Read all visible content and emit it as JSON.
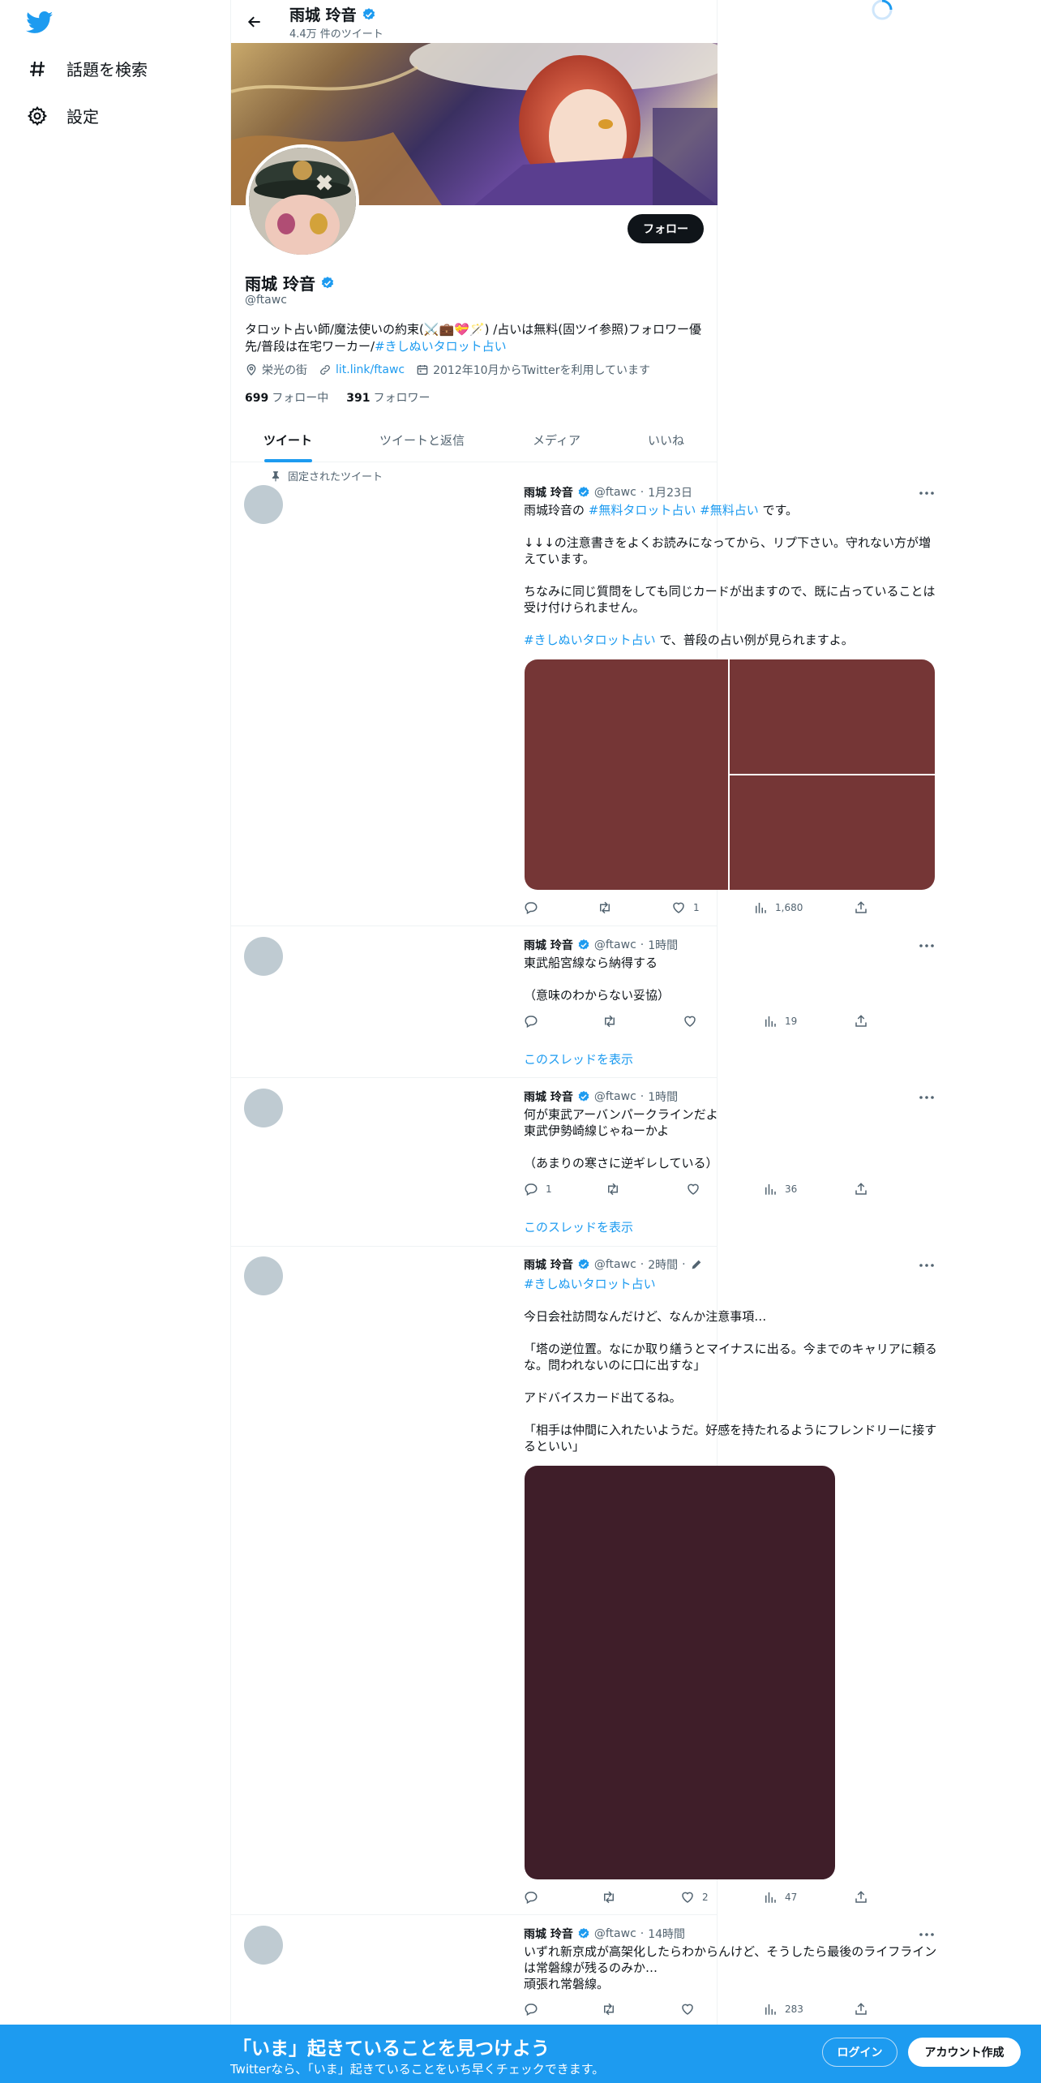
{
  "nav": {
    "logo_icon": "twitter-bird-icon",
    "items": [
      {
        "label": "話題を検索",
        "icon": "hashtag-icon"
      },
      {
        "label": "設定",
        "icon": "gear-icon"
      }
    ]
  },
  "header": {
    "name": "雨城 玲音",
    "tweet_count": "4.4万 件のツイート"
  },
  "profile": {
    "name": "雨城 玲音",
    "handle": "@ftawc",
    "follow_label": "フォロー",
    "bio_text": "タロット占い師/魔法使いの約束(⚔️💼💝🪄) /占いは無料(固ツイ参照)フォロワー優先/普段は在宅ワーカー/",
    "bio_hashtag": "#きしぬいタロット占い",
    "location": "栄光の街",
    "url": "lit.link/ftawc",
    "joined": "2012年10月からTwitterを利用しています",
    "following_count": "699",
    "following_label": "フォロー中",
    "followers_count": "391",
    "followers_label": "フォロワー"
  },
  "tabs": [
    "ツイート",
    "ツイートと返信",
    "メディア",
    "いいね"
  ],
  "pinned_label": "固定されたツイート",
  "tweets": [
    {
      "name": "雨城 玲音",
      "handle": "@ftawc",
      "time": "1月23日",
      "body_pre": "雨城玲音の ",
      "tag1": "#無料タロット占い",
      "tag2": "#無料占い",
      "body_post": " です。",
      "para2": "↓↓↓の注意書きをよくお読みになってから、リプ下さい。守れない方が増えています。",
      "para3": "ちなみに同じ質問をしても同じカードが出ますので、既に占っていることは受け付けられません。",
      "tag3": "#きしぬいタロット占い",
      "para4": " で、普段の占い例が見られますよ。",
      "replies": "",
      "retweets": "",
      "likes": "1",
      "views": "1,680",
      "media_color": "#753636"
    },
    {
      "name": "雨城 玲音",
      "handle": "@ftawc",
      "time": "1時間",
      "body": "東武船宮線なら納得する\n\n（意味のわからない妥協）",
      "replies": "",
      "retweets": "",
      "likes": "",
      "views": "19",
      "thread": "このスレッドを表示"
    },
    {
      "name": "雨城 玲音",
      "handle": "@ftawc",
      "time": "1時間",
      "body": "何が東武アーバンパークラインだよ\n東武伊勢崎線じゃねーかよ\n\n（あまりの寒さに逆ギレしている）",
      "replies": "1",
      "retweets": "",
      "likes": "",
      "views": "36",
      "thread": "このスレッドを表示"
    },
    {
      "name": "雨城 玲音",
      "handle": "@ftawc",
      "time": "2時間",
      "tag": "#きしぬいタロット占い",
      "body": "今日会社訪問なんだけど、なんか注意事項…\n\n「塔の逆位置。なにか取り繕うとマイナスに出る。今までのキャリアに頼るな。問われないのに口に出すな」\n\nアドバイスカード出てるね。\n\n「相手は仲間に入れたいようだ。好感を持たれるようにフレンドリーに接するといい」",
      "replies": "",
      "retweets": "",
      "likes": "2",
      "views": "47",
      "media_color": "#3f1e29"
    },
    {
      "name": "雨城 玲音",
      "handle": "@ftawc",
      "time": "14時間",
      "body": "いずれ新京成が高架化したらわからんけど、そうしたら最後のライフラインは常磐線が残るのみか…\n頑張れ常磐線。",
      "replies": "",
      "retweets": "",
      "likes": "",
      "views": "283"
    }
  ],
  "bottom": {
    "title": "「いま」起きていることを見つけよう",
    "subtitle": "Twitterなら、「いま」起きていることをいち早くチェックできます。",
    "login": "ログイン",
    "signup": "アカウント作成"
  },
  "colors": {
    "accent": "#1d9bf0",
    "text": "#0f1419",
    "muted": "#536471"
  }
}
